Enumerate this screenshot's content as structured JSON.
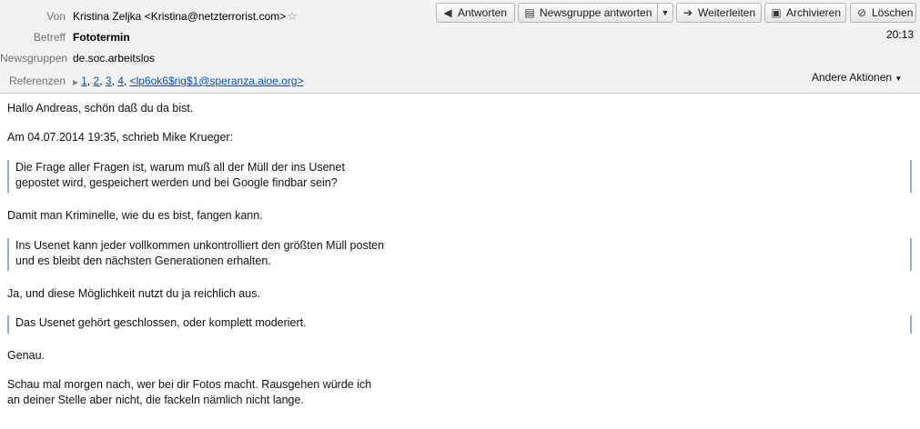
{
  "header": {
    "from_label": "Von",
    "from_value": "Kristina Zeljka <Kristina@netzterrorist.com>",
    "subject_label": "Betreff",
    "subject_value": "Fototermin",
    "newsgroups_label": "Newsgruppen",
    "newsgroups_value": "de.soc.arbeitslos",
    "references_label": "Referenzen",
    "references": [
      "1",
      "2",
      "3",
      "4",
      "<lp6ok6$rig$1@speranza.aioe.org>"
    ],
    "time": "20:13",
    "more_actions": "Andere Aktionen"
  },
  "toolbar": {
    "reply": "Antworten",
    "reply_newsgroup": "Newsgruppe antworten",
    "forward": "Weiterleiten",
    "archive": "Archivieren",
    "delete": "Löschen"
  },
  "message": {
    "greeting": "Hallo Andreas, schön daß du da bist.",
    "attribution": "Am 04.07.2014 19:35, schrieb Mike Krueger:",
    "quote1_line1": "Die Frage aller Fragen ist, warum muß all der Müll der ins Usenet",
    "quote1_line2": "gepostet wird, gespeichert werden und bei Google findbar sein?",
    "reply1": "Damit man Kriminelle, wie du es bist, fangen kann.",
    "quote2_line1": "Ins Usenet kann jeder vollkommen unkontrolliert den größten Müll posten",
    "quote2_line2": "und es bleibt den nächsten Generationen erhalten.",
    "reply2": "Ja, und diese Möglichkeit nutzt du ja reichlich aus.",
    "quote3_line1": "Das Usenet gehört geschlossen, oder komplett moderiert.",
    "reply3": "Genau.",
    "closing_line1": "Schau mal morgen nach, wer bei dir Fotos macht. Rausgehen würde ich",
    "closing_line2": "an deiner Stelle aber nicht, die fackeln nämlich nicht lange."
  }
}
